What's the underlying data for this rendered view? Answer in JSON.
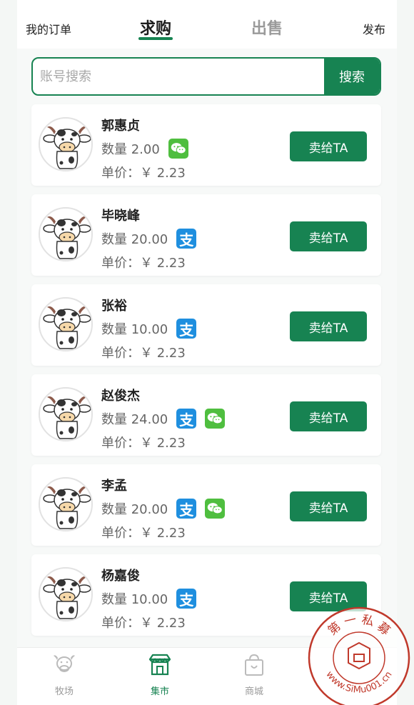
{
  "header": {
    "my_orders": "我的订单",
    "tab_buy": "求购",
    "tab_sell": "出售",
    "publish": "发布"
  },
  "search": {
    "placeholder": "账号搜索",
    "button": "搜索"
  },
  "orders": [
    {
      "name": "郭惠贞",
      "quantity": "数量 2.00",
      "price": "单价：￥ 2.23",
      "payments": [
        "wechat"
      ],
      "button": "卖给TA"
    },
    {
      "name": "毕晓峰",
      "quantity": "数量 20.00",
      "price": "单价：￥ 2.23",
      "payments": [
        "alipay"
      ],
      "button": "卖给TA"
    },
    {
      "name": "张裕",
      "quantity": "数量 10.00",
      "price": "单价：￥ 2.23",
      "payments": [
        "alipay"
      ],
      "button": "卖给TA"
    },
    {
      "name": "赵俊杰",
      "quantity": "数量 24.00",
      "price": "单价：￥ 2.23",
      "payments": [
        "alipay",
        "wechat"
      ],
      "button": "卖给TA"
    },
    {
      "name": "李孟",
      "quantity": "数量 20.00",
      "price": "单价：￥ 2.23",
      "payments": [
        "alipay",
        "wechat"
      ],
      "button": "卖给TA"
    },
    {
      "name": "杨嘉俊",
      "quantity": "数量 10.00",
      "price": "单价：￥ 2.23",
      "payments": [
        "alipay"
      ],
      "button": "卖给TA"
    }
  ],
  "payment_icons": {
    "alipay": "支",
    "wechat": "wechat-icon"
  },
  "tabbar": [
    {
      "label": "牧场",
      "icon": "cow-icon",
      "active": false
    },
    {
      "label": "集市",
      "icon": "market-icon",
      "active": true
    },
    {
      "label": "商城",
      "icon": "shopping-bag-icon",
      "active": false
    }
  ],
  "watermark": {
    "top_text": "第 一 私 募",
    "bottom_text": "www.SiMu001.cn"
  },
  "colors": {
    "accent": "#178352",
    "alipay": "#1f8fdf",
    "wechat": "#4fbe3f",
    "text_muted": "#666666"
  }
}
